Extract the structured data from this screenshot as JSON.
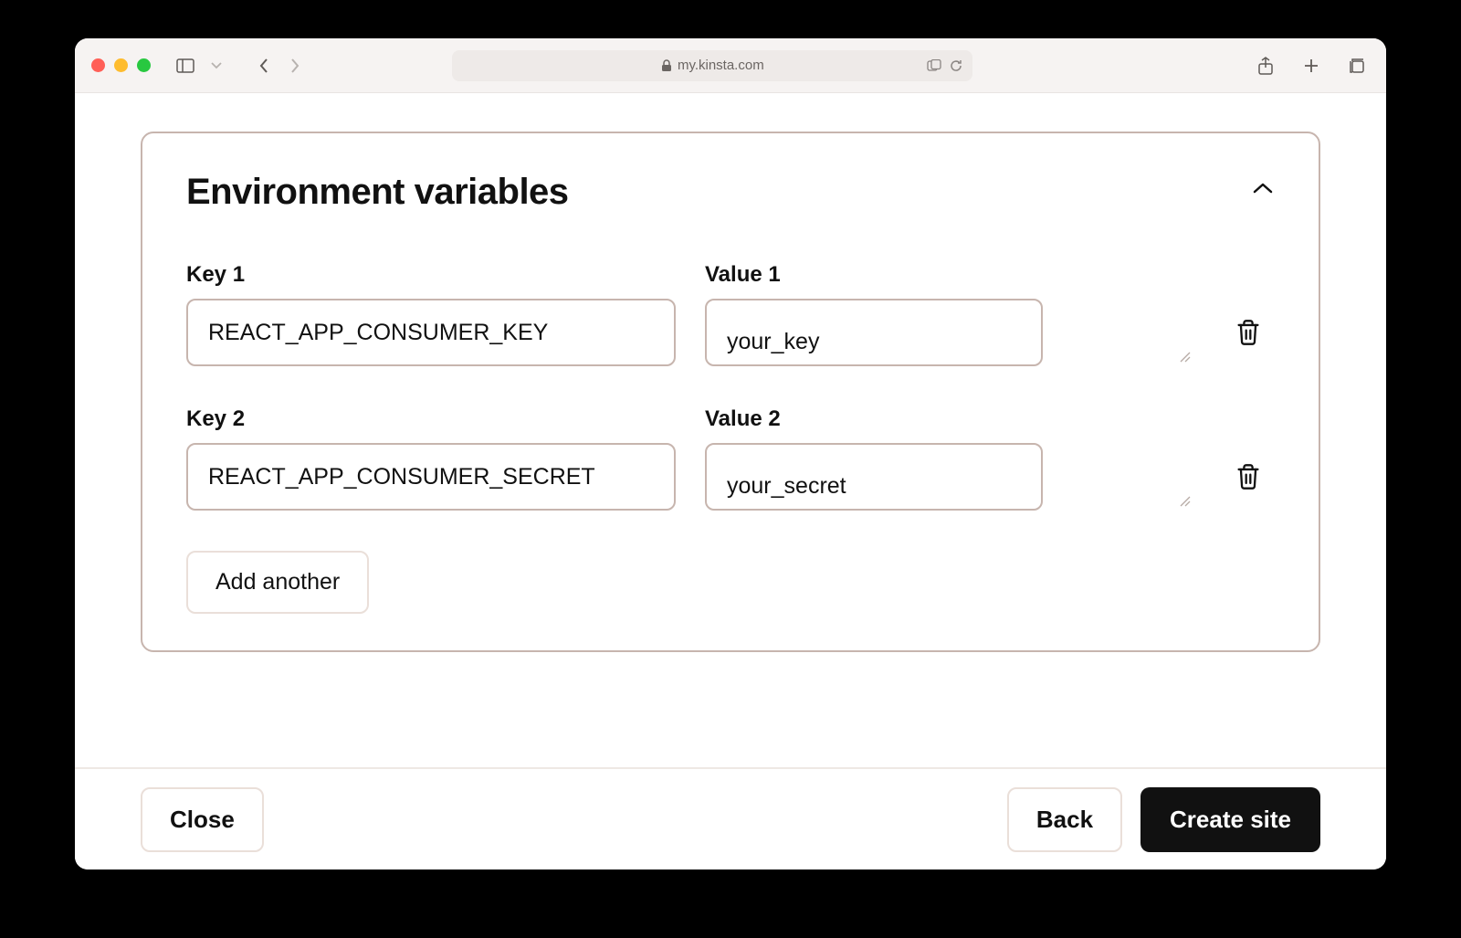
{
  "browser": {
    "url_host": "my.kinsta.com"
  },
  "panel": {
    "title": "Environment variables"
  },
  "env_rows": [
    {
      "key_label": "Key 1",
      "key_value": "REACT_APP_CONSUMER_KEY",
      "value_label": "Value 1",
      "value_value": "your_key"
    },
    {
      "key_label": "Key 2",
      "key_value": "REACT_APP_CONSUMER_SECRET",
      "value_label": "Value 2",
      "value_value": "your_secret"
    }
  ],
  "buttons": {
    "add_another": "Add another",
    "close": "Close",
    "back": "Back",
    "create_site": "Create site"
  }
}
